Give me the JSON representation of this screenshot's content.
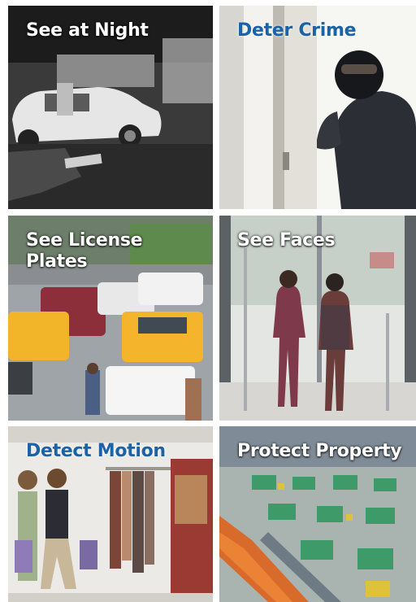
{
  "tiles": [
    {
      "label": "See at Night",
      "label_style": "light"
    },
    {
      "label": "Deter Crime",
      "label_style": "blue"
    },
    {
      "label": "See License Plates",
      "label_style": "light"
    },
    {
      "label": "See Faces",
      "label_style": "light"
    },
    {
      "label": "Detect Motion",
      "label_style": "blue"
    },
    {
      "label": "Protect Property",
      "label_style": "light"
    }
  ],
  "colors": {
    "blue_caption": "#1a63a8",
    "light_caption": "#ffffff"
  }
}
